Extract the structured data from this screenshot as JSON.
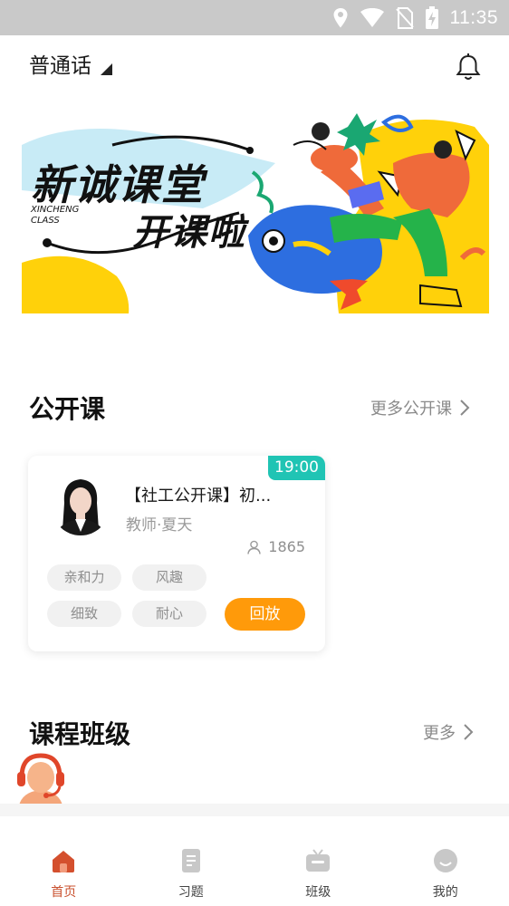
{
  "status_bar": {
    "time": "11:35"
  },
  "header": {
    "language": "普通话"
  },
  "banner": {
    "headline_line1": "新诚课堂",
    "headline_line2": "开课啦",
    "brand_en_line1": "XINCHENG",
    "brand_en_line2": "CLASS"
  },
  "open_course": {
    "section_title": "公开课",
    "more_label": "更多公开课",
    "card": {
      "time": "19:00",
      "title": "【社工公开课】初...",
      "teacher": "教师·夏天",
      "viewers": "1865",
      "tags": [
        "亲和力",
        "风趣",
        "细致",
        "耐心"
      ],
      "action_label": "回放"
    }
  },
  "class_section": {
    "title": "课程班级",
    "more_label": "更多"
  },
  "bottom_nav": {
    "items": [
      {
        "label": "首页",
        "active": true
      },
      {
        "label": "习题",
        "active": false
      },
      {
        "label": "班级",
        "active": false
      },
      {
        "label": "我的",
        "active": false
      }
    ]
  },
  "colors": {
    "accent_orange": "#ff9a0a",
    "badge_teal": "#20c4b4",
    "nav_active": "#c9502e",
    "status_bar": "#c9c9c9"
  }
}
